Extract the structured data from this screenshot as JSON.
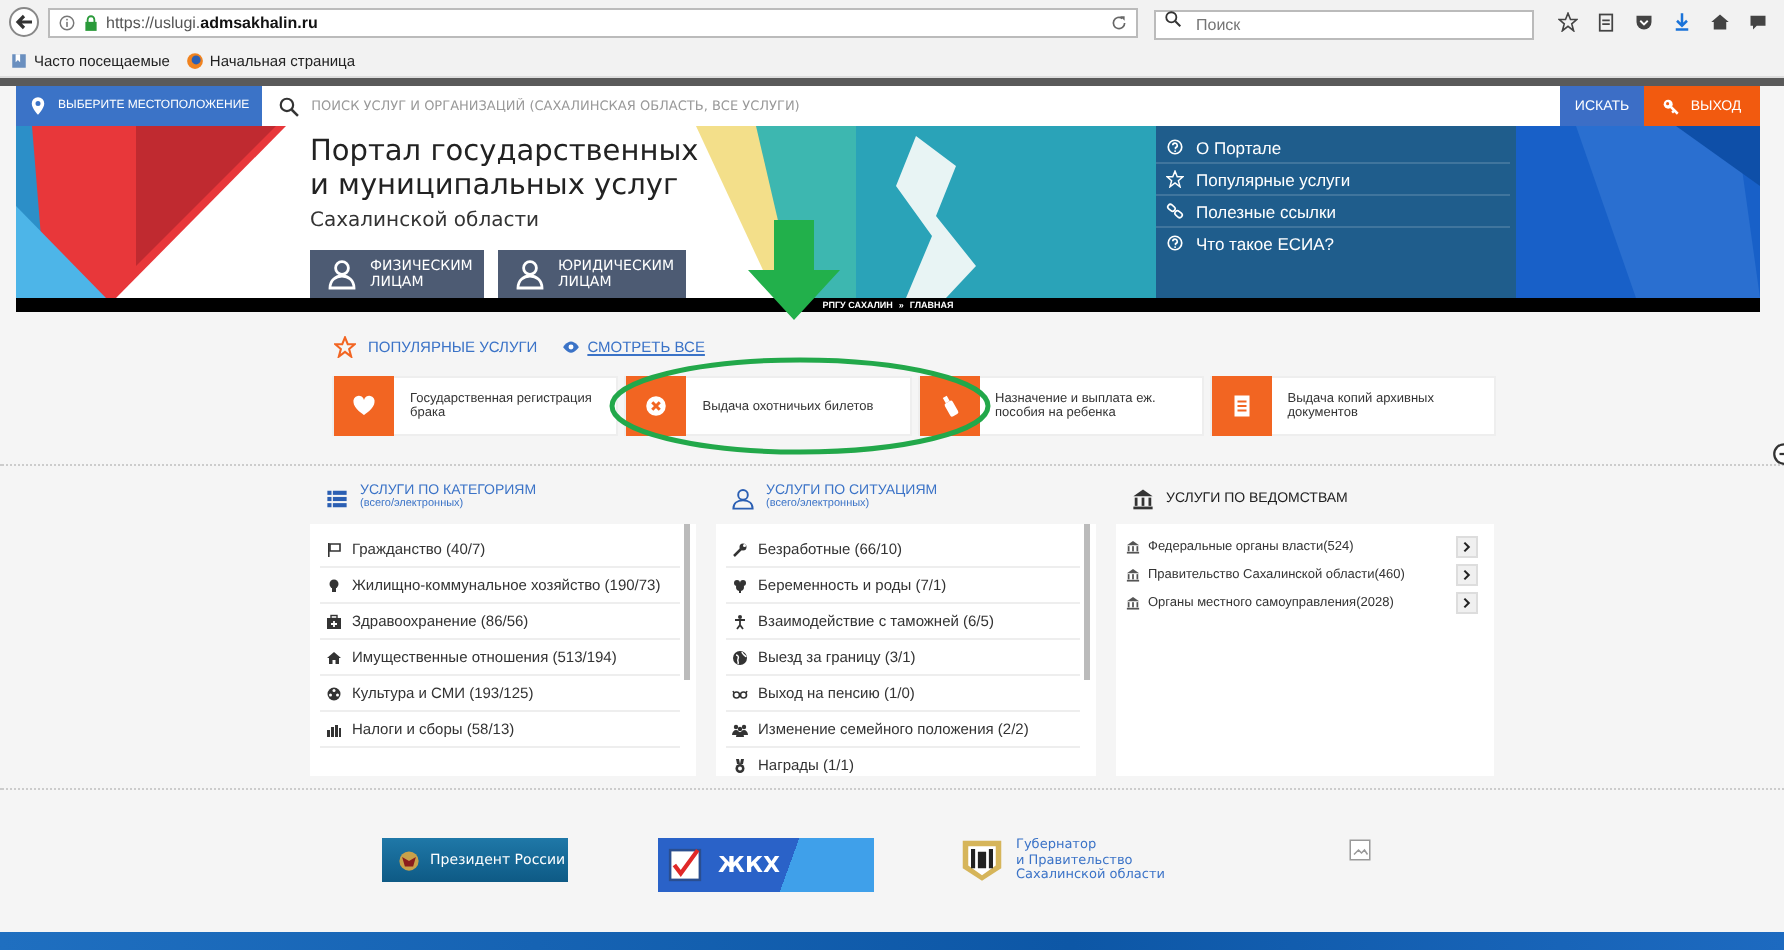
{
  "browser": {
    "url": "https://uslugi.**admsakhalin.ru**",
    "search_placeholder": "Поиск",
    "bookmarks": [
      "Часто посещаемые",
      "Начальная страница"
    ]
  },
  "site_bar": {
    "location_button": "ВЫБЕРИТЕ МЕСТОПОЛОЖЕНИЕ",
    "search_placeholder": "ПОИСК УСЛУГ И ОРГАНИЗАЦИЙ (САХАЛИНСКАЯ ОБЛАСТЬ, ВСЕ УСЛУГИ)",
    "search_button": "ИСКАТЬ",
    "logout_button": "ВЫХОД"
  },
  "header": {
    "title_lines": [
      "Портал государственных",
      "и муниципальных услуг"
    ],
    "subtitle": "Сахалинской области",
    "audience_buttons": [
      "ФИЗИЧЕСКИМ ЛИЦАМ",
      "ЮРИДИЧЕСКИМ ЛИЦАМ"
    ],
    "menu": [
      "О Портале",
      "Популярные услуги",
      "Полезные ссылки",
      "Что такое ЕСИА?"
    ]
  },
  "breadcrumb": {
    "items": [
      "РПГУ САХАЛИН",
      "ГЛАВНАЯ"
    ],
    "separator": "»"
  },
  "popular": {
    "title": "ПОПУЛЯРНЫЕ УСЛУГИ",
    "see_all": "СМОТРЕТЬ ВСЕ",
    "cards": [
      "Государственная регистрация брака",
      "Выдача охотничьих билетов",
      "Назначение и выплата еж. пособия на ребенка",
      "Выдача копий архивных документов"
    ]
  },
  "categories": {
    "title": "УСЛУГИ ПО КАТЕГОРИЯМ",
    "subtitle": "(всего/электронных)",
    "items": [
      "Гражданство (40/7)",
      "Жилищно-коммунальное хозяйство (190/73)",
      "Здравоохранение (86/56)",
      "Имущественные отношения (513/194)",
      "Культура и СМИ (193/125)",
      "Налоги и сборы (58/13)"
    ]
  },
  "situations": {
    "title": "УСЛУГИ ПО СИТУАЦИЯМ",
    "subtitle": "(всего/электронных)",
    "items": [
      "Безработные (66/10)",
      "Беременность и роды (7/1)",
      "Взаимодействие с таможней (6/5)",
      "Выезд за границу (3/1)",
      "Выход на пенсию (1/0)",
      "Изменение семейного положения (2/2)",
      "Награды (1/1)"
    ]
  },
  "departments": {
    "title": "УСЛУГИ ПО ВЕДОМСТВАМ",
    "items": [
      "Федеральные органы власти(524)",
      "Правительство Сахалинской области(460)",
      "Органы местного самоуправления(2028)"
    ]
  },
  "footer": {
    "links": [
      {
        "kind": "president",
        "label": "Президент России"
      },
      {
        "kind": "jkh",
        "label": "ЖКХ"
      },
      {
        "kind": "governor",
        "label": "Губернатор\nи Правительство\nСахалинской области"
      },
      {
        "kind": "broken-image"
      }
    ]
  }
}
